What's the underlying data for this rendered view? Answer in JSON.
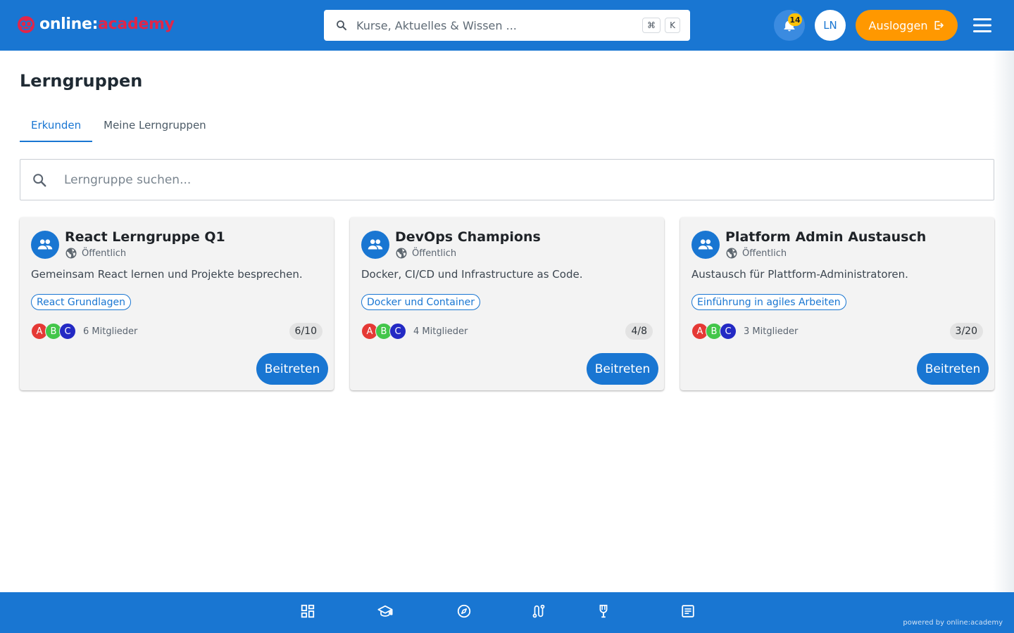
{
  "header": {
    "logo_part1": "online:",
    "logo_part2": "academy",
    "search_placeholder": "Kurse, Aktuelles & Wissen ...",
    "shortcut_key1": "⌘",
    "shortcut_key2": "K",
    "notification_count": "14",
    "user_initials": "LN",
    "logout_label": "Ausloggen"
  },
  "page": {
    "title": "Lerngruppen",
    "tabs": [
      {
        "label": "Erkunden",
        "active": true
      },
      {
        "label": "Meine Lerngruppen",
        "active": false
      }
    ],
    "search_placeholder": "Lerngruppe suchen..."
  },
  "groups": [
    {
      "name": "React Lerngruppe Q1",
      "visibility": "Öffentlich",
      "description": "Gemeinsam React lernen und Projekte besprechen.",
      "course": "React Grundlagen",
      "avatars": [
        "A",
        "B",
        "C"
      ],
      "members_label": "6 Mitglieder",
      "capacity": "6/10",
      "join_label": "Beitreten"
    },
    {
      "name": "DevOps Champions",
      "visibility": "Öffentlich",
      "description": "Docker, CI/CD und Infrastructure as Code.",
      "course": "Docker und Container",
      "avatars": [
        "A",
        "B",
        "C"
      ],
      "members_label": "4 Mitglieder",
      "capacity": "4/8",
      "join_label": "Beitreten"
    },
    {
      "name": "Platform Admin Austausch",
      "visibility": "Öffentlich",
      "description": "Austausch für Plattform-Administratoren.",
      "course": "Einführung in agiles Arbeiten",
      "avatars": [
        "A",
        "B",
        "C"
      ],
      "members_label": "3 Mitglieder",
      "capacity": "3/20",
      "join_label": "Beitreten"
    }
  ],
  "bottom_nav": {
    "items": [
      "dashboard-icon",
      "school-icon",
      "compass-icon",
      "route-icon",
      "trophy-icon",
      "article-icon"
    ],
    "powered_by": "powered by online:academy"
  },
  "colors": {
    "primary": "#1976d2",
    "accent": "#ff9800",
    "brand_red": "#e0264a",
    "badge": "#ffc107"
  }
}
